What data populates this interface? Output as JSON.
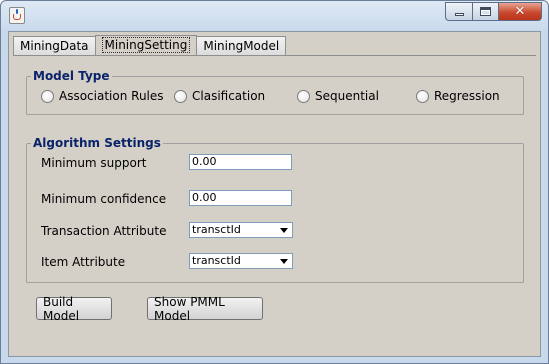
{
  "window": {
    "title": "",
    "controls": {
      "minimize": "minimize",
      "maximize": "maximize",
      "close": "close"
    }
  },
  "tabs": [
    {
      "label": "MiningData",
      "active": false
    },
    {
      "label": "MiningSetting",
      "active": true
    },
    {
      "label": "MiningModel",
      "active": false
    }
  ],
  "model_type": {
    "title": "Model Type",
    "options": [
      {
        "label": "Association Rules",
        "selected": false
      },
      {
        "label": "Clasification",
        "selected": false
      },
      {
        "label": "Sequential",
        "selected": false
      },
      {
        "label": "Regression",
        "selected": false
      }
    ]
  },
  "algorithm_settings": {
    "title": "Algorithm Settings",
    "min_support": {
      "label": "Minimum support",
      "value": "0.00"
    },
    "min_confidence": {
      "label": "Minimum confidence",
      "value": "0.00"
    },
    "transaction_attribute": {
      "label": "Transaction Attribute",
      "selected": "transctId"
    },
    "item_attribute": {
      "label": "Item Attribute",
      "selected": "transctId"
    }
  },
  "buttons": {
    "build_model": "Build Model",
    "show_pmml": "Show PMML Model"
  },
  "icons": {
    "app": "java-icon"
  }
}
